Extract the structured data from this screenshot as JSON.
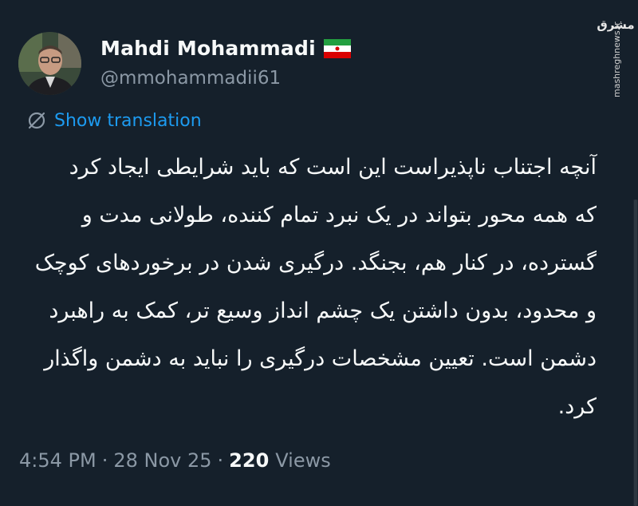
{
  "author": {
    "display_name": "Mahdi Mohammadi",
    "handle": "@mmohammadii61"
  },
  "translate": {
    "label": "Show translation"
  },
  "tweet": {
    "lines": [
      "آنچه اجتناب ناپذیراست این است که باید شرایطی ایجاد کرد",
      "که همه محور بتواند در یک نبرد تمام کننده، طولانی مدت و",
      "گسترده، در کنار هم، بجنگد. درگیری شدن در برخوردهای کوچک",
      "و محدود، بدون داشتن یک چشم انداز وسیع تر، کمک به راهبرد",
      "دشمن است. تعیین مشخصات درگیری را نباید به دشمن واگذار",
      "کرد."
    ]
  },
  "meta": {
    "time": "4:54 PM",
    "separator": "·",
    "date": "28 Nov 25",
    "views_count": "220",
    "views_label": "Views"
  },
  "watermark": {
    "line1": "مشرق",
    "line2": "mashreghnews.ir"
  },
  "colors": {
    "background": "#15202b",
    "text_primary": "#f7f9f9",
    "text_secondary": "#8b98a5",
    "accent": "#1d9bf0"
  },
  "icons": {
    "translate": "globe-slash-icon",
    "flag": "iran-flag-icon"
  }
}
